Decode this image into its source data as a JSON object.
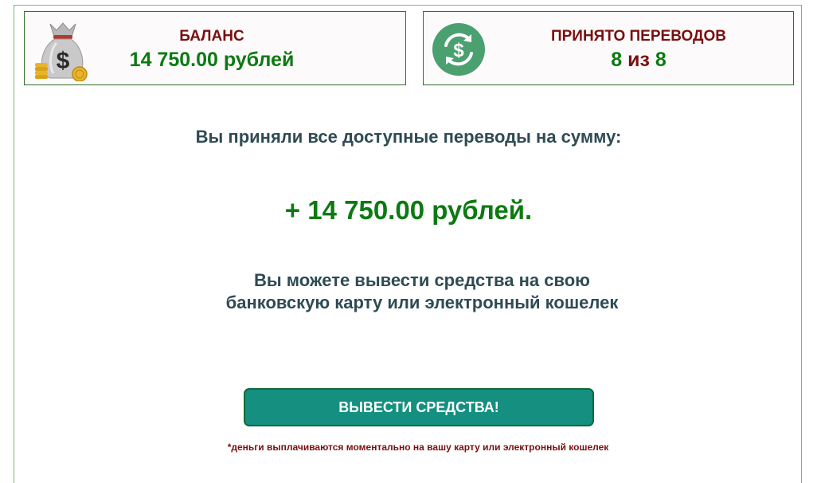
{
  "balance_card": {
    "title": "БАЛАНС",
    "value": "14 750.00 рублей",
    "icon": "money-bag-icon"
  },
  "transfers_card": {
    "title": "ПРИНЯТО ПЕРЕВОДОВ",
    "accepted": "8",
    "separator": "из",
    "total": "8",
    "icon": "currency-exchange-icon"
  },
  "main": {
    "message": "Вы приняли все доступные переводы на сумму:",
    "amount": "+ 14 750.00 рублей.",
    "info_line1": "Вы можете вывести средства на свою",
    "info_line2": "банковскую карту или электронный кошелек",
    "button_label": "ВЫВЕСТИ СРЕДСТВА!",
    "footnote": "*деньги выплачиваются моментально на вашу карту или электронный кошелек"
  },
  "colors": {
    "accent_green": "#0c7a12",
    "title_red": "#7a0f0f",
    "button_teal": "#148f80",
    "text_slate": "#2f4b54"
  }
}
